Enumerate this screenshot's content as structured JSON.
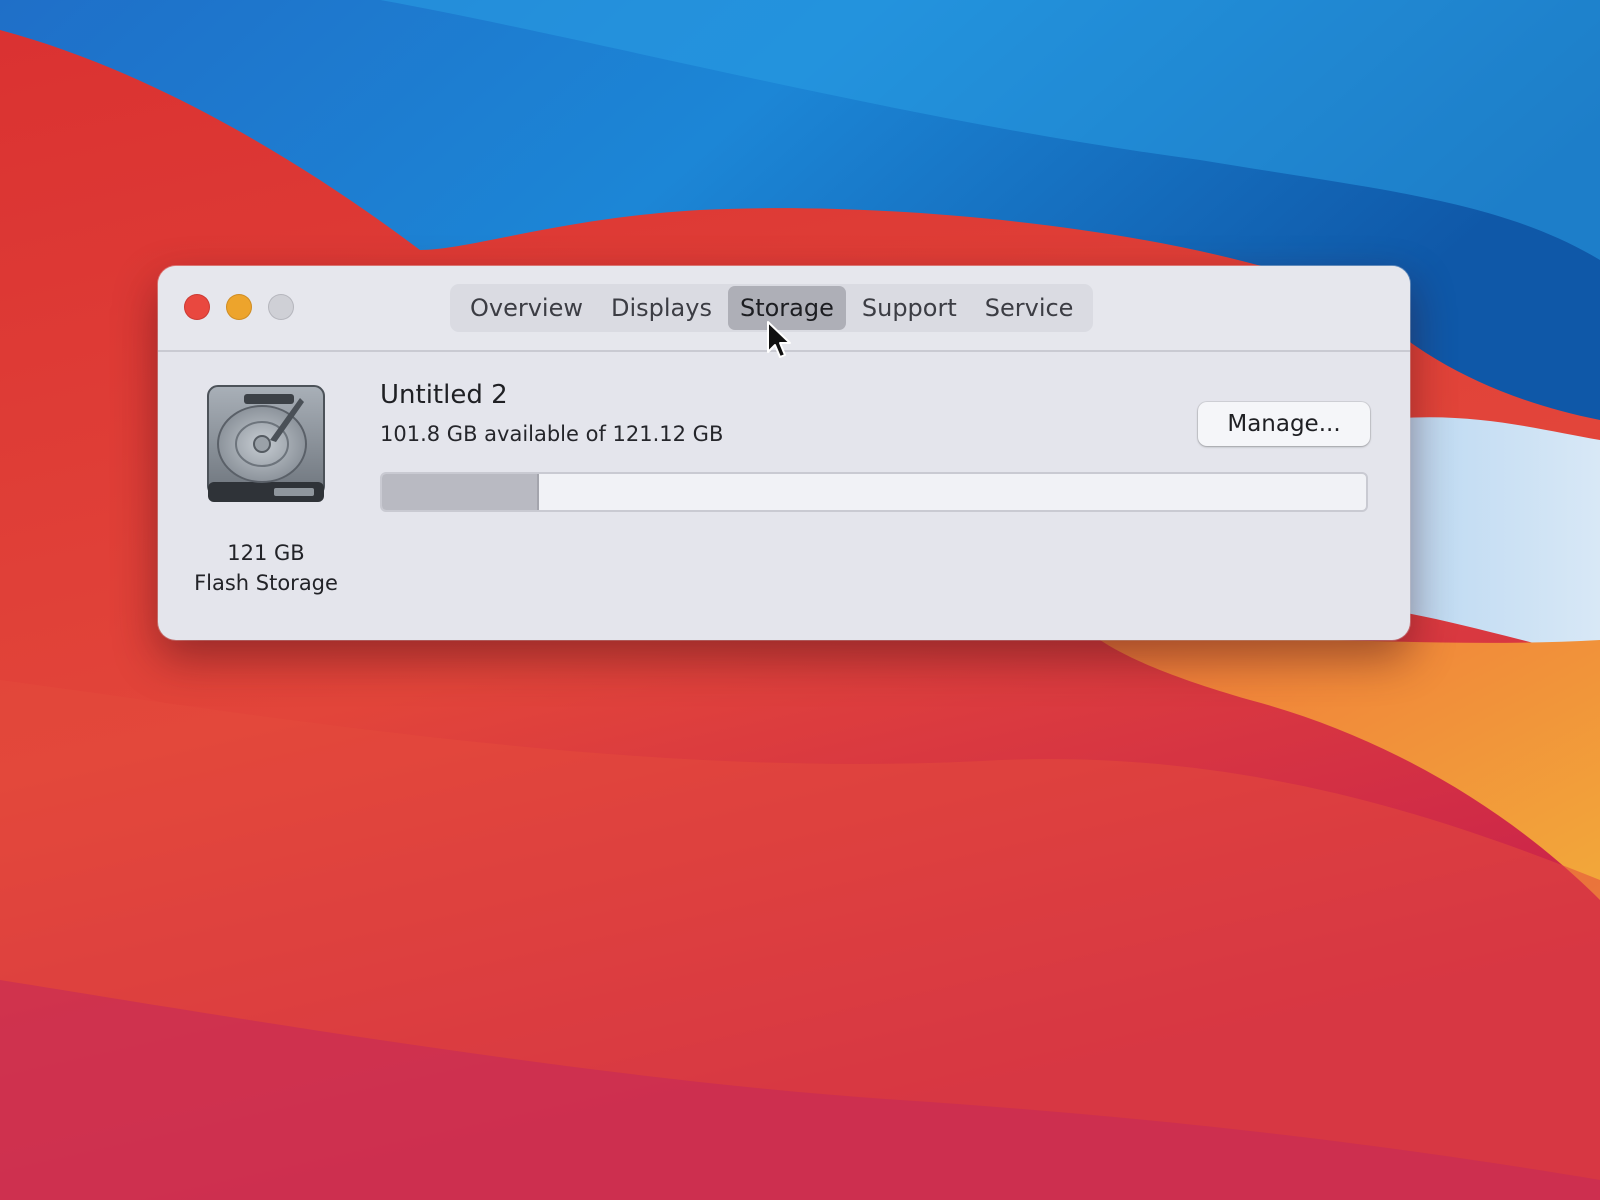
{
  "window": {
    "tabs": [
      {
        "label": "Overview",
        "selected": false
      },
      {
        "label": "Displays",
        "selected": false
      },
      {
        "label": "Storage",
        "selected": true
      },
      {
        "label": "Support",
        "selected": false
      },
      {
        "label": "Service",
        "selected": false
      }
    ]
  },
  "drive": {
    "icon": "hard-drive-icon",
    "capacity": "121 GB",
    "type": "Flash Storage"
  },
  "volume": {
    "name": "Untitled 2",
    "available_text": "101.8 GB available of 121.12 GB",
    "used_fraction": 0.16
  },
  "buttons": {
    "manage_label": "Manage..."
  },
  "colors": {
    "close": "#e9483f",
    "minimize": "#eda42c",
    "zoom": "#cfd0d6",
    "selected_tab": "#aeafb7"
  }
}
